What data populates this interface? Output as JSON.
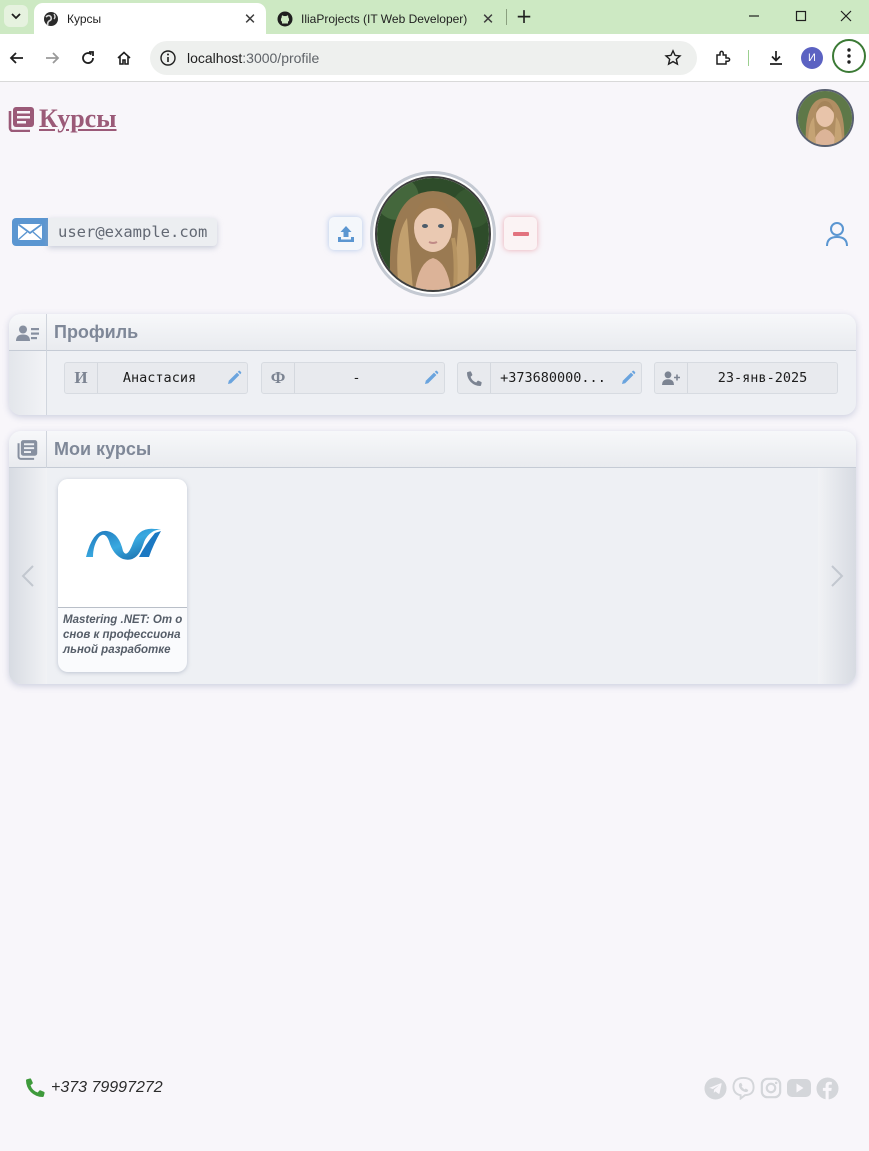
{
  "browser": {
    "tabs": [
      {
        "title": "Курсы",
        "active": true
      },
      {
        "title": "IliaProjects (IT Web Developer)",
        "active": false
      }
    ],
    "url_host": "localhost",
    "url_path": ":3000/profile",
    "profile_initial": "И"
  },
  "header": {
    "brand": "Курсы"
  },
  "profile_top": {
    "email": "user@example.com"
  },
  "profile": {
    "title": "Профиль",
    "fields": [
      {
        "lead": "И",
        "value": "Анастасия"
      },
      {
        "lead": "Ф",
        "value": "-"
      },
      {
        "lead_icon": "phone-icon",
        "value": "+373680000..."
      },
      {
        "lead_icon": "user-plus-icon",
        "value": "23-янв-2025"
      }
    ]
  },
  "courses": {
    "title": "Мои курсы",
    "items": [
      {
        "title": "Mastering .NET: От основ к профессиональной разработке",
        "icon": "dotnet-logo"
      }
    ]
  },
  "footer": {
    "phone": "+373 79997272",
    "socials": [
      "telegram-icon",
      "viber-icon",
      "instagram-icon",
      "youtube-icon",
      "facebook-icon"
    ]
  },
  "colors": {
    "brand": "#9b5a78",
    "accent": "#5b96d1",
    "danger": "#e2737f",
    "phone_green": "#3f9a3c"
  }
}
